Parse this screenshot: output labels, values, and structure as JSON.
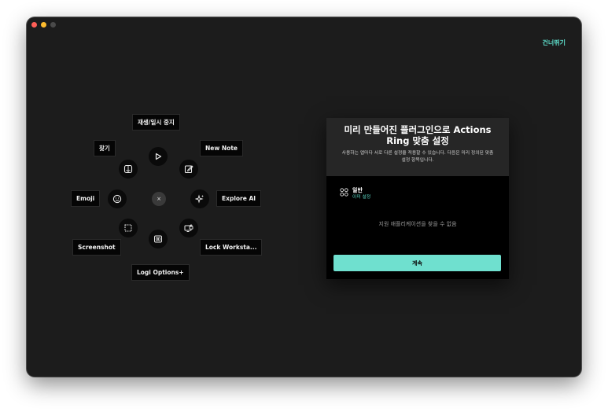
{
  "header": {
    "skip_label": "건너뛰기"
  },
  "ring": {
    "center_label": "×",
    "labels": {
      "play_pause": "재생/일시 중지",
      "find": "찾기",
      "new_note": "New Note",
      "emoji": "Emoji",
      "explore_ai": "Explore AI",
      "screenshot": "Screenshot",
      "lock_workstation": "Lock Worksta...",
      "logi_options": "Logi Options+"
    }
  },
  "card": {
    "title": "미리 만들어진 플러그인으로 Actions Ring 맞춤 설정",
    "description": "사용하는 앱마다 서로 다른 설정을 적용할 수 있습니다. 다음은 미리 정의된 맞춤 설정 항목입니다.",
    "category": {
      "name": "일반",
      "status": "이미 설정"
    },
    "empty_message": "지원 애플리케이션을 찾을 수 없음",
    "continue_label": "계속"
  },
  "colors": {
    "accent": "#5ddcc9",
    "button": "#6fe0cf",
    "background": "#1c1c1c"
  }
}
